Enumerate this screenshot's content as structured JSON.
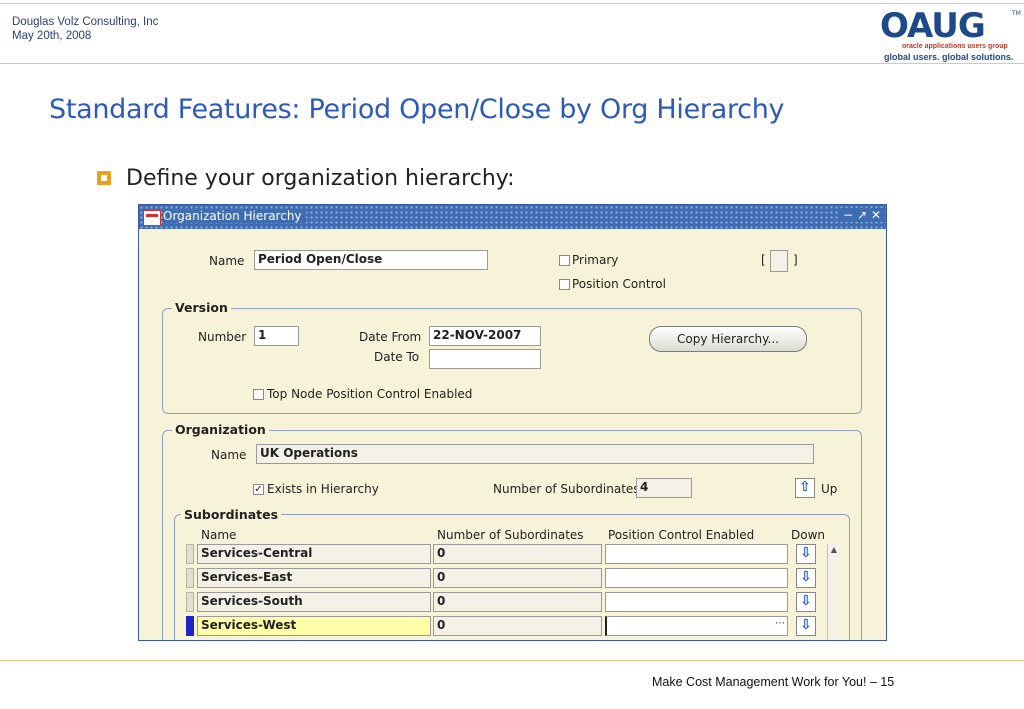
{
  "header": {
    "company": "Douglas Volz Consulting, Inc",
    "date": "May 20th, 2008"
  },
  "logo": {
    "word": "OAUG",
    "tm": "TM",
    "line1": "oracle applications users group",
    "line2": "global users.  global solutions."
  },
  "slide": {
    "title": "Standard Features:  Period Open/Close by Org Hierarchy",
    "bullet": "Define your organization hierarchy:",
    "footer": "Make Cost Management Work for You! – 15"
  },
  "window": {
    "title": "Organization Hierarchy",
    "name_label": "Name",
    "name_value": "Period Open/Close",
    "primary_label": "Primary",
    "position_control_label": "Position Control",
    "bracket_left": "[",
    "bracket_right": "]",
    "version": {
      "title": "Version",
      "number_label": "Number",
      "number_value": "1",
      "date_from_label": "Date From",
      "date_from_value": "22-NOV-2007",
      "date_to_label": "Date To",
      "date_to_value": "",
      "copy_button": "Copy Hierarchy...",
      "top_node_label": "Top Node Position Control Enabled"
    },
    "organization": {
      "title": "Organization",
      "name_label": "Name",
      "name_value": "UK Operations",
      "exists_label": "Exists in Hierarchy",
      "num_sub_label": "Number of Subordinates",
      "num_sub_value": "4",
      "up_label": "Up"
    },
    "subordinates": {
      "title": "Subordinates",
      "columns": [
        "Name",
        "Number of Subordinates",
        "Position Control Enabled",
        "Down"
      ],
      "rows": [
        {
          "name": "Services-Central",
          "count": "0",
          "pos": ""
        },
        {
          "name": "Services-East",
          "count": "0",
          "pos": ""
        },
        {
          "name": "Services-South",
          "count": "0",
          "pos": ""
        },
        {
          "name": "Services-West",
          "count": "0",
          "pos": ""
        }
      ]
    }
  }
}
